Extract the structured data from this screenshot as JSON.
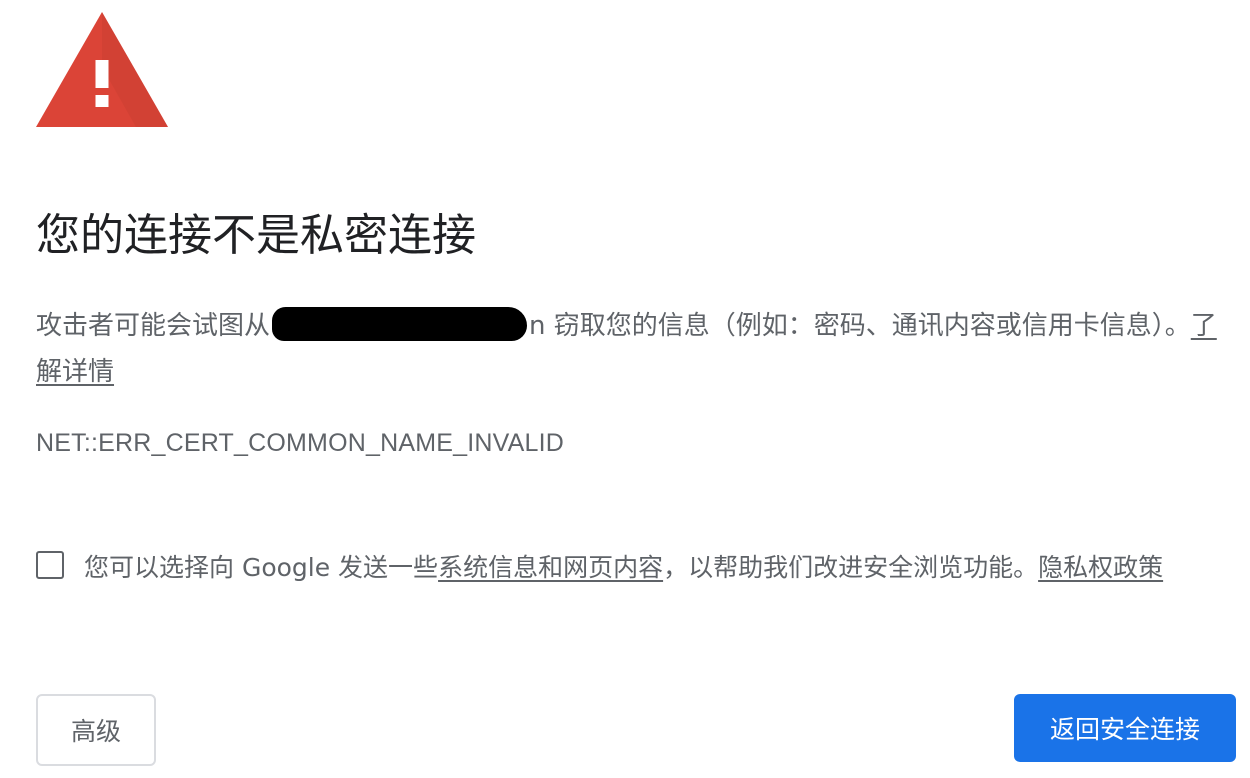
{
  "icon": "warning-triangle-icon",
  "colors": {
    "warning_red": "#db4437",
    "primary_blue": "#1a73e8",
    "text_dark": "#202124",
    "text_gray": "#5f6368"
  },
  "title": "您的连接不是私密连接",
  "description": {
    "prefix": "攻击者可能会试图从",
    "domain_suffix": "n",
    "suffix": " 窃取您的信息（例如：密码、通讯内容或信用卡信息）。",
    "learn_more": "了解详情"
  },
  "error_code": "NET::ERR_CERT_COMMON_NAME_INVALID",
  "opt_in": {
    "checked": false,
    "prefix": "您可以选择向 Google 发送一些",
    "link_system_info": "系统信息和网页内容",
    "middle": "，以帮助我们改进安全浏览功能。",
    "link_privacy": "隐私权政策"
  },
  "buttons": {
    "advanced": "高级",
    "back_to_safety": "返回安全连接"
  }
}
